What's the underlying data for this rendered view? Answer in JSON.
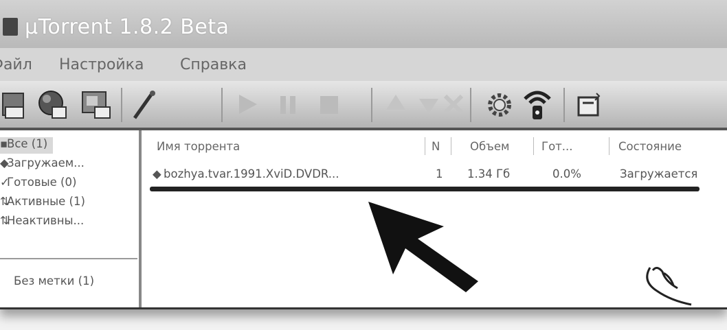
{
  "window": {
    "title": "µTorrent 1.8.2 Beta"
  },
  "menu": {
    "items": [
      "Файл",
      "Настройка",
      "Справка"
    ]
  },
  "toolbar": {
    "icons": [
      "add-torrent-icon",
      "add-url-icon",
      "create-torrent-icon",
      "wand-icon",
      "start-icon",
      "pause-icon",
      "stop-icon",
      "move-up-icon",
      "move-down-icon",
      "remove-icon",
      "settings-icon",
      "remote-icon",
      "rss-icon"
    ]
  },
  "sidebar": {
    "items": [
      {
        "label": "Все (1)",
        "selected": true
      },
      {
        "label": "Загружаем..."
      },
      {
        "label": "Готовые (0)"
      },
      {
        "label": "Активные (1)"
      },
      {
        "label": "Неактивны..."
      }
    ],
    "labels_section": {
      "label": "Без метки (1)"
    }
  },
  "torrent_list": {
    "columns": {
      "name": "Имя торрента",
      "num": "N",
      "size": "Объем",
      "done": "Гот...",
      "status": "Состояние"
    },
    "rows": [
      {
        "name": "bozhya.tvar.1991.XviD.DVDR...",
        "num": "1",
        "size": "1.34 Гб",
        "done": "0.0%",
        "status": "Загружается"
      }
    ]
  },
  "annotation": {
    "arrow": "arrow-annotation",
    "underline": "underline-annotation",
    "cursor": "hand-cursor-icon"
  },
  "colors": {
    "titlebar": "#c4c4c4",
    "selection": "#d9d9d9",
    "annotation": "#222222"
  }
}
